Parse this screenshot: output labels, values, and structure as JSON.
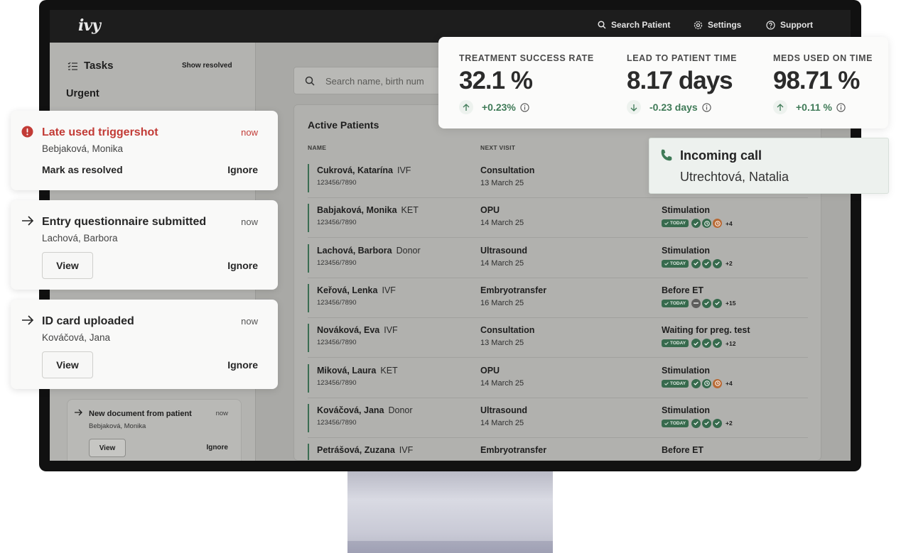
{
  "app": {
    "logo": "ivy"
  },
  "topnav": {
    "search_label": "Search Patient",
    "settings_label": "Settings",
    "support_label": "Support"
  },
  "tasks": {
    "title": "Tasks",
    "show_resolved": "Show resolved",
    "section": "Urgent",
    "background_card": {
      "title": "New document from patient",
      "time": "now",
      "patient": "Bebjaková, Monika",
      "view": "View",
      "ignore": "Ignore"
    }
  },
  "search": {
    "placeholder": "Search name, birth num"
  },
  "patients": {
    "title": "Active Patients",
    "columns": {
      "name": "NAME",
      "visit": "NEXT VISIT"
    },
    "today_label": "TODAY",
    "rows": [
      {
        "name": "Cukrová, Katarína",
        "tag": "IVF",
        "id": "123456/7890",
        "visit": "Consultation",
        "date": "13 March 25",
        "stage": "",
        "badges": [],
        "extra": ""
      },
      {
        "name": "Babjaková, Monika",
        "tag": "KET",
        "id": "123456/7890",
        "visit": "OPU",
        "date": "14 March 25",
        "stage": "Stimulation",
        "badges": [
          "ok",
          "clock",
          "warn"
        ],
        "extra": "+4"
      },
      {
        "name": "Lachová, Barbora",
        "tag": "Donor",
        "id": "123456/7890",
        "visit": "Ultrasound",
        "date": "14 March 25",
        "stage": "Stimulation",
        "badges": [
          "ok",
          "ok",
          "ok"
        ],
        "extra": "+2"
      },
      {
        "name": "Keřová, Lenka",
        "tag": "IVF",
        "id": "123456/7890",
        "visit": "Embryotransfer",
        "date": "16 March 25",
        "stage": "Before ET",
        "badges": [
          "grey",
          "ok",
          "ok"
        ],
        "extra": "+15"
      },
      {
        "name": "Nováková, Eva",
        "tag": "IVF",
        "id": "123456/7890",
        "visit": "Consultation",
        "date": "13 March 25",
        "stage": "Waiting for preg. test",
        "badges": [
          "ok",
          "ok",
          "ok"
        ],
        "extra": "+12"
      },
      {
        "name": "Miková, Laura",
        "tag": "KET",
        "id": "123456/7890",
        "visit": "OPU",
        "date": "14 March 25",
        "stage": "Stimulation",
        "badges": [
          "ok",
          "clock",
          "warn"
        ],
        "extra": "+4"
      },
      {
        "name": "Kováčová, Jana",
        "tag": "Donor",
        "id": "123456/7890",
        "visit": "Ultrasound",
        "date": "14 March 25",
        "stage": "Stimulation",
        "badges": [
          "ok",
          "ok",
          "ok"
        ],
        "extra": "+2"
      },
      {
        "name": "Petrášová, Zuzana",
        "tag": "IVF",
        "id": "",
        "visit": "Embryotransfer",
        "date": "",
        "stage": "Before ET",
        "badges": [],
        "extra": ""
      }
    ]
  },
  "notifications": [
    {
      "title": "Late used triggershot",
      "time": "now",
      "patient": "Bebjaková, Monika",
      "action": "Mark as resolved",
      "ignore": "Ignore"
    },
    {
      "title": "Entry questionnaire submitted",
      "time": "now",
      "patient": "Lachová, Barbora",
      "action": "View",
      "ignore": "Ignore"
    },
    {
      "title": "ID card uploaded",
      "time": "now",
      "patient": "Kováčová, Jana",
      "action": "View",
      "ignore": "Ignore"
    }
  ],
  "stats": [
    {
      "label": "TREATMENT SUCCESS RATE",
      "value": "32.1 %",
      "delta": "+0.23%",
      "direction": "up"
    },
    {
      "label": "LEAD TO PATIENT TIME",
      "value": "8.17 days",
      "delta": "-0.23 days",
      "direction": "down"
    },
    {
      "label": "MEDS USED ON TIME",
      "value": "98.71 %",
      "delta": "+0.11 %",
      "direction": "up"
    }
  ],
  "call": {
    "title": "Incoming call",
    "caller": "Utrechtová, Natalia"
  },
  "colors": {
    "accent_green": "#3f7a57",
    "alert_red": "#c23b36",
    "warning_orange": "#b86a35"
  }
}
